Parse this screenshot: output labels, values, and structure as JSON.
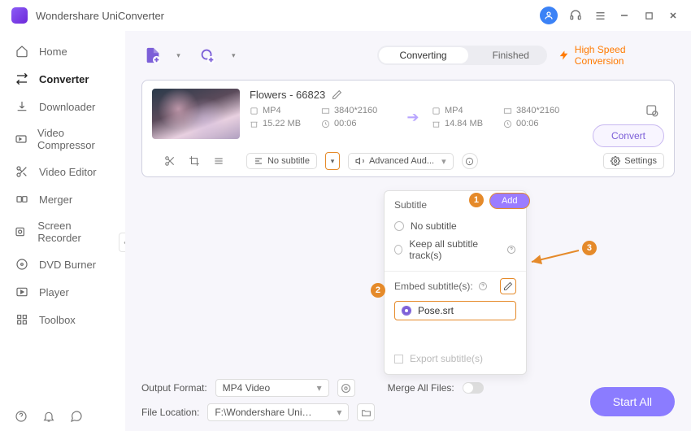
{
  "app": {
    "title": "Wondershare UniConverter"
  },
  "titlebar": {
    "icons": {
      "user": "user-icon",
      "headset": "headset-icon",
      "menu": "menu-icon",
      "min": "minimize-icon",
      "max": "maximize-icon",
      "close": "close-icon"
    }
  },
  "sidebar": {
    "items": [
      {
        "label": "Home",
        "icon": "home-icon"
      },
      {
        "label": "Converter",
        "icon": "converter-icon",
        "active": true
      },
      {
        "label": "Downloader",
        "icon": "download-icon"
      },
      {
        "label": "Video Compressor",
        "icon": "compress-icon"
      },
      {
        "label": "Video Editor",
        "icon": "scissors-icon"
      },
      {
        "label": "Merger",
        "icon": "merge-icon"
      },
      {
        "label": "Screen Recorder",
        "icon": "record-icon"
      },
      {
        "label": "DVD Burner",
        "icon": "disc-icon"
      },
      {
        "label": "Player",
        "icon": "play-icon"
      },
      {
        "label": "Toolbox",
        "icon": "grid-icon"
      }
    ]
  },
  "topbar": {
    "tabs": {
      "converting": "Converting",
      "finished": "Finished"
    },
    "highspeed": "High Speed Conversion"
  },
  "file": {
    "name": "Flowers - 66823",
    "src": {
      "format": "MP4",
      "resolution": "3840*2160",
      "size": "15.22 MB",
      "duration": "00:06"
    },
    "dst": {
      "format": "MP4",
      "resolution": "3840*2160",
      "size": "14.84 MB",
      "duration": "00:06"
    },
    "convert_label": "Convert"
  },
  "cardbar": {
    "subtitle_label": "No subtitle",
    "audio_label": "Advanced Aud...",
    "settings_label": "Settings"
  },
  "dropdown": {
    "title": "Subtitle",
    "opt_none": "No subtitle",
    "opt_keep": "Keep all subtitle track(s)",
    "embed_label": "Embed subtitle(s):",
    "file": "Pose.srt",
    "export_label": "Export subtitle(s)",
    "add_label": "Add"
  },
  "callouts": {
    "n1": "1",
    "n2": "2",
    "n3": "3"
  },
  "bottom": {
    "outfmt_label": "Output Format:",
    "outfmt_value": "MP4 Video",
    "merge_label": "Merge All Files:",
    "loc_label": "File Location:",
    "loc_value": "F:\\Wondershare UniConverter",
    "startall": "Start All"
  }
}
